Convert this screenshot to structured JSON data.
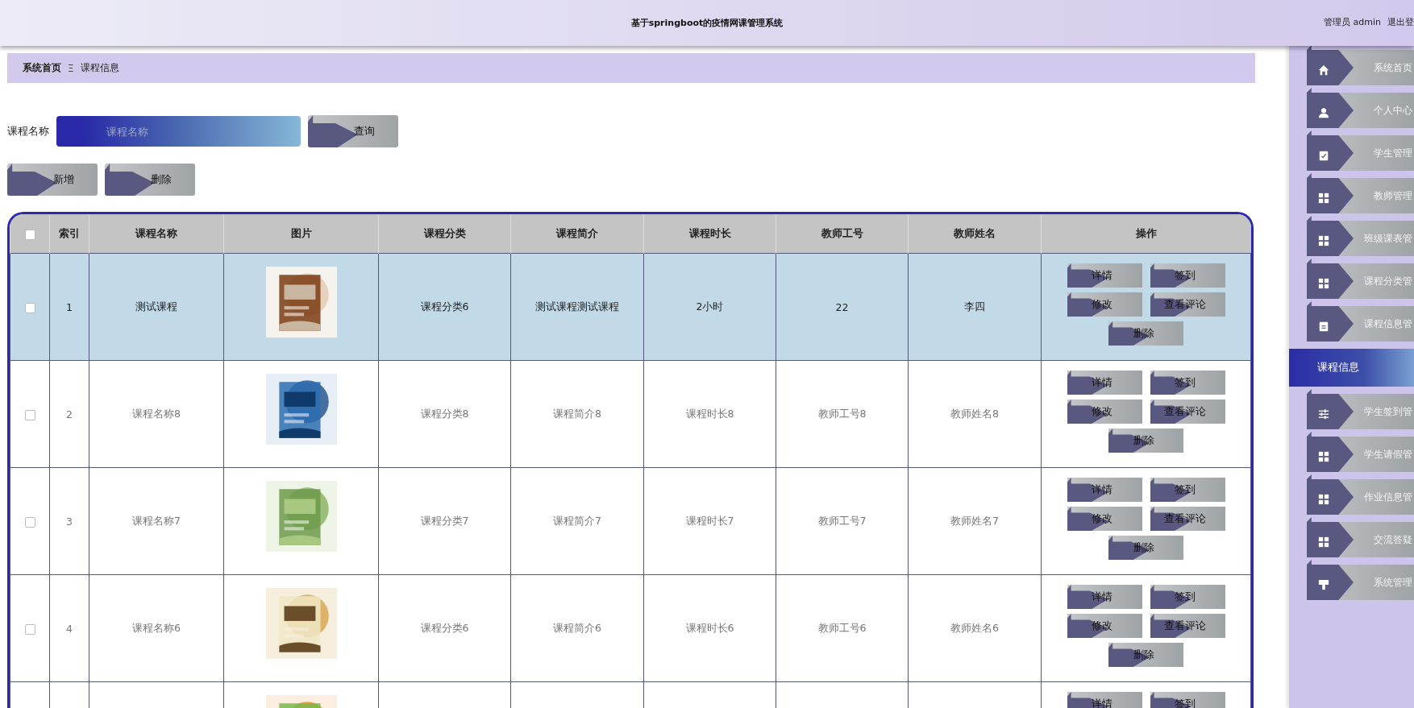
{
  "header": {
    "title": "基于springboot的疫情网课管理系统",
    "user": "管理员 admin",
    "logout": "退出登"
  },
  "breadcrumb": {
    "home": "系统首页",
    "separator": "Ξ",
    "current": "课程信息"
  },
  "search": {
    "label": "课程名称",
    "placeholder": "课程名称",
    "button": "查询"
  },
  "toolbar": [
    "新增",
    "删除"
  ],
  "table": {
    "header_checked": false,
    "columns": [
      "索引",
      "课程名称",
      "图片",
      "课程分类",
      "课程简介",
      "课程时长",
      "教师工号",
      "教师姓名",
      "操作"
    ],
    "rows": [
      {
        "selected": true,
        "checked": false,
        "index": "1",
        "name": "测试课程",
        "category": "课程分类6",
        "intro": "测试课程测试课程",
        "duration": "2小时",
        "teacher_no": "22",
        "teacher_name": "李四",
        "actions": [
          "详情",
          "签到",
          "修改",
          "查看评论",
          "删除"
        ]
      },
      {
        "selected": false,
        "checked": false,
        "index": "2",
        "name": "课程名称8",
        "category": "课程分类8",
        "intro": "课程简介8",
        "duration": "课程时长8",
        "teacher_no": "教师工号8",
        "teacher_name": "教师姓名8",
        "actions": [
          "详情",
          "签到",
          "修改",
          "查看评论",
          "删除"
        ]
      },
      {
        "selected": false,
        "checked": false,
        "index": "3",
        "name": "课程名称7",
        "category": "课程分类7",
        "intro": "课程简介7",
        "duration": "课程时长7",
        "teacher_no": "教师工号7",
        "teacher_name": "教师姓名7",
        "actions": [
          "详情",
          "签到",
          "修改",
          "查看评论",
          "删除"
        ]
      },
      {
        "selected": false,
        "checked": false,
        "index": "4",
        "name": "课程名称6",
        "category": "课程分类6",
        "intro": "课程简介6",
        "duration": "课程时长6",
        "teacher_no": "教师工号6",
        "teacher_name": "教师姓名6",
        "actions": [
          "详情",
          "签到",
          "修改",
          "查看评论",
          "删除"
        ]
      },
      {
        "selected": false,
        "actions": [
          "详情",
          "签到"
        ]
      }
    ]
  },
  "sidebar": {
    "items": [
      {
        "label": "系统首页",
        "selected": false
      },
      {
        "label": "个人中心",
        "selected": false
      },
      {
        "label": "学生管理",
        "selected": false
      },
      {
        "label": "教师管理",
        "selected": false
      },
      {
        "label": "班级课表管",
        "selected": false
      },
      {
        "label": "课程分类管",
        "selected": false
      },
      {
        "label": "课程信息管",
        "selected": false
      },
      {
        "label": "课程信息",
        "selected": true
      },
      {
        "label": "学生签到管",
        "selected": false
      },
      {
        "label": "学生请假管",
        "selected": false
      },
      {
        "label": "作业信息管",
        "selected": false
      },
      {
        "label": "交流答疑",
        "selected": false
      },
      {
        "label": "系统管理",
        "selected": false
      }
    ]
  }
}
